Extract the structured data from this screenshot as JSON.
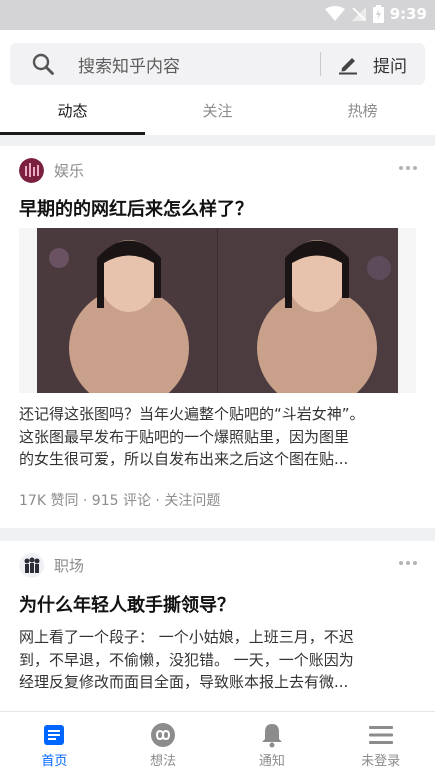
{
  "status_bar": {
    "time": "9:39"
  },
  "search": {
    "placeholder": "搜索知乎内容",
    "ask_label": "提问"
  },
  "tabs": [
    {
      "label": "动态",
      "active": true
    },
    {
      "label": "关注",
      "active": false
    },
    {
      "label": "热榜",
      "active": false
    }
  ],
  "feed": [
    {
      "topic": "娱乐",
      "title": "早期的的网红后来怎么样了？",
      "excerpt_lines": [
        "还记得这张图吗？当年火遍整个贴吧的“斗岩女神”。",
        "这张图最早发布于贴吧的一个爆照贴里，因为图里",
        "的女生很可爱，所以自发布出来之后这个图在贴..."
      ],
      "meta": "17K 赞同 · 915 评论 · 关注问题"
    },
    {
      "topic": "职场",
      "title": "为什么年轻人敢手撕领导？",
      "excerpt_lines": [
        "网上看了一个段子： 一个小姑娘，上班三月，不迟",
        "到，不早退，不偷懒，没犯错。 一天，一个账因为",
        "经理反复修改而面目全面，导致账本报上去有微..."
      ]
    }
  ],
  "bottom_nav": [
    {
      "label": "首页",
      "icon": "home-icon",
      "active": true
    },
    {
      "label": "想法",
      "icon": "ideas-icon",
      "active": false
    },
    {
      "label": "通知",
      "icon": "bell-icon",
      "active": false
    },
    {
      "label": "未登录",
      "icon": "menu-icon",
      "active": false
    }
  ],
  "colors": {
    "accent": "#0066ff",
    "status_bar": "#d4d4d6"
  }
}
